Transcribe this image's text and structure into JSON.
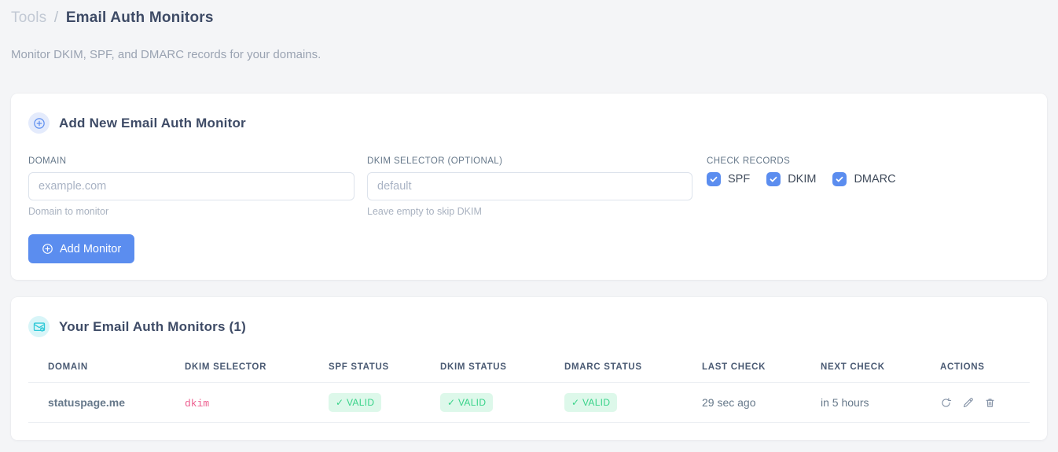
{
  "page": {
    "breadcrumb": {
      "section": "Tools",
      "separator": "/",
      "current": "Email Auth Monitors"
    },
    "subtitle": "Monitor DKIM, SPF, and DMARC records for your domains."
  },
  "add_card": {
    "icon": "plus-circle-icon",
    "title": "Add New Email Auth Monitor",
    "fields": {
      "domain": {
        "label": "DOMAIN",
        "value": "",
        "placeholder": "example.com",
        "helper": "Domain to monitor"
      },
      "dkim_selector": {
        "label": "DKIM SELECTOR (OPTIONAL)",
        "value": "",
        "placeholder": "default",
        "helper": "Leave empty to skip DKIM"
      }
    },
    "check_records": {
      "label": "CHECK RECORDS",
      "options": [
        {
          "label": "SPF",
          "checked": true
        },
        {
          "label": "DKIM",
          "checked": true
        },
        {
          "label": "DMARC",
          "checked": true
        }
      ]
    },
    "submit_label": "Add Monitor",
    "submit_icon": "plus-circle-icon"
  },
  "monitors_card": {
    "icon": "mail-check-icon",
    "title": "Your Email Auth Monitors (1)",
    "count": 1,
    "table": {
      "headers": [
        "DOMAIN",
        "DKIM SELECTOR",
        "SPF STATUS",
        "DKIM STATUS",
        "DMARC STATUS",
        "LAST CHECK",
        "NEXT CHECK",
        "ACTIONS"
      ],
      "rows": [
        {
          "domain": "statuspage.me",
          "dkim_selector": "dkim",
          "spf_status": "✓ VALID",
          "dkim_status": "✓ VALID",
          "dmarc_status": "✓ VALID",
          "last_check": "29 sec ago",
          "next_check": "in 5 hours",
          "actions": [
            "refresh-icon",
            "edit-icon",
            "delete-icon"
          ]
        }
      ]
    }
  },
  "colors": {
    "accent_blue": "#5b8def",
    "accent_blue_light": "#e4ebfc",
    "teal": "#2fc9d8",
    "teal_light": "#d8f5f8",
    "success_text": "#38d389",
    "success_bg": "#ddf8ea",
    "code_pink": "#ed5f8f",
    "heading": "#3e4b66",
    "muted": "#9aa3b2",
    "page_bg": "#f4f5f7"
  }
}
